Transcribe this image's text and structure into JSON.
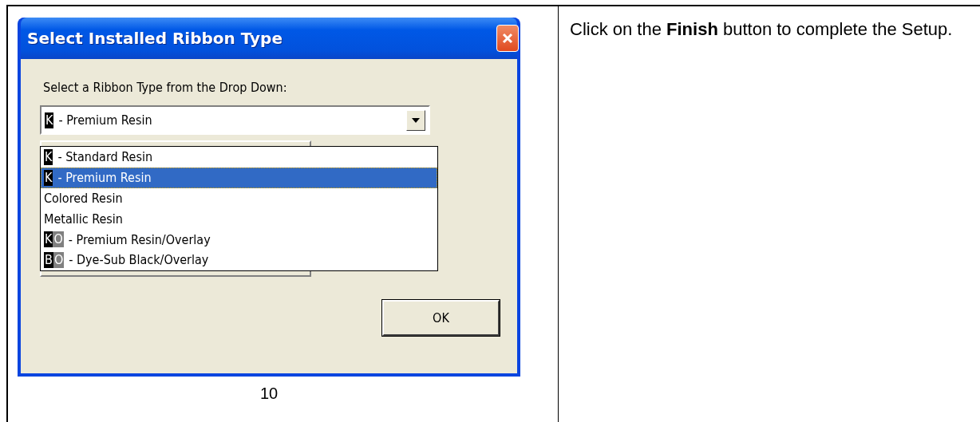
{
  "dialog": {
    "title": "Select Installed Ribbon Type",
    "prompt": "Select a Ribbon Type from the Drop Down:",
    "combo": {
      "codes": [
        {
          "letter": "K",
          "color": "#000000"
        }
      ],
      "value": "- Premium Resin",
      "expanded": true
    },
    "options": [
      {
        "codes": [
          {
            "letter": "K",
            "color": "#000000"
          }
        ],
        "label": "- Standard Resin",
        "selected": false
      },
      {
        "codes": [
          {
            "letter": "K",
            "color": "#000000"
          }
        ],
        "label": "- Premium Resin",
        "selected": true
      },
      {
        "label": "Colored Resin",
        "selected": false
      },
      {
        "label": "Metallic Resin",
        "selected": false
      },
      {
        "codes": [
          {
            "letter": "K",
            "color": "#000000"
          },
          {
            "letter": "O",
            "color": "#808080"
          }
        ],
        "label": "- Premium Resin/Overlay",
        "selected": false
      },
      {
        "codes": [
          {
            "letter": "B",
            "color": "#000000"
          },
          {
            "letter": "O",
            "color": "#808080"
          }
        ],
        "label": "- Dye-Sub Black/Overlay",
        "selected": false
      }
    ],
    "buttons": [
      {
        "label": "OK"
      }
    ]
  },
  "page": {
    "number": "10",
    "instruction": "Click on the **Finish** button to complete the Setup."
  }
}
